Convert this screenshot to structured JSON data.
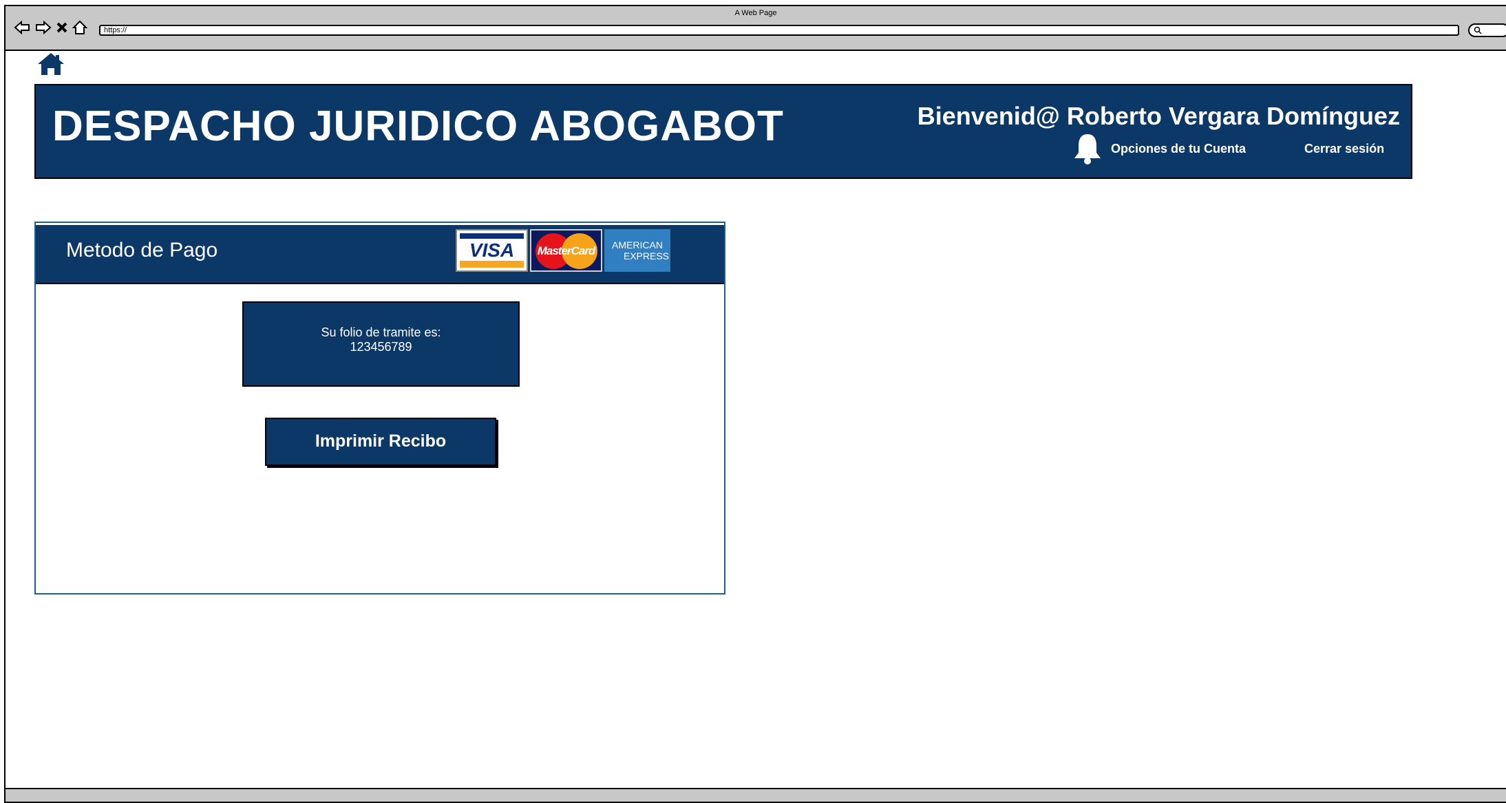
{
  "window": {
    "title": "A Web Page"
  },
  "toolbar": {
    "url": "https://"
  },
  "header": {
    "brand": "DESPACHO JURIDICO ABOGABOT",
    "welcome": "Bienvenid@ Roberto Vergara Domínguez",
    "account_options": "Opciones de tu Cuenta",
    "logout": "Cerrar sesión"
  },
  "payment": {
    "title": "Metodo de Pago",
    "cards": {
      "visa": "VISA",
      "mastercard": "MasterCard",
      "amex_line1": "AMERICAN",
      "amex_line2": "EXPRESS"
    },
    "folio_label": "Su folio de tramite es:",
    "folio_number": "123456789",
    "print_button": "Imprimir Recibo"
  },
  "colors": {
    "primary": "#0b3866",
    "chrome": "#c8c8c8",
    "panel_border": "#1e5c96"
  }
}
